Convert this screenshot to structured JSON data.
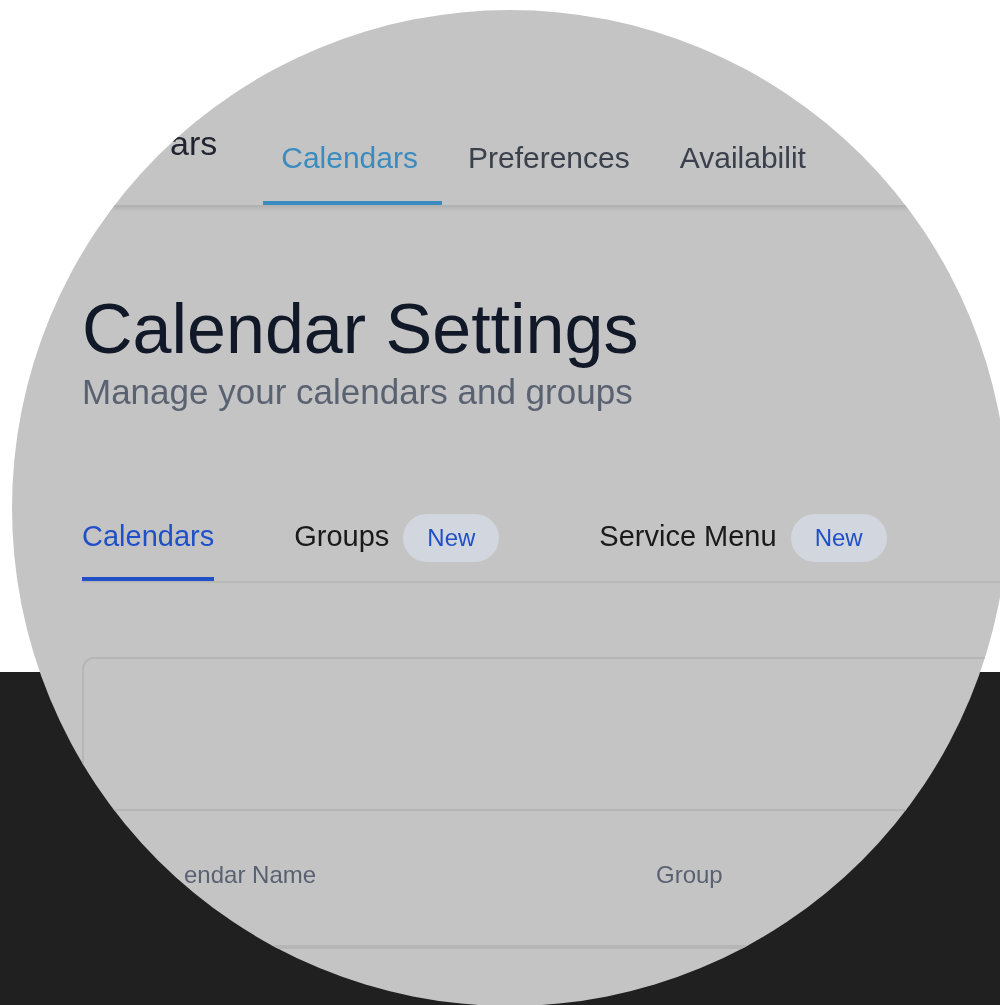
{
  "top_nav": {
    "title_fragment": "ars",
    "tabs": [
      {
        "label": "Calendars",
        "selected": true
      },
      {
        "label": "Preferences",
        "selected": false
      },
      {
        "label": "Availabilit",
        "selected": false
      }
    ]
  },
  "page": {
    "title": "Calendar Settings",
    "subtitle": "Manage your calendars and groups"
  },
  "tabs": [
    {
      "label": "Calendars",
      "selected": true
    },
    {
      "label": "Groups",
      "selected": false,
      "badge": "New"
    },
    {
      "label": "Service Menu",
      "selected": false,
      "badge": "New"
    }
  ],
  "table": {
    "columns": [
      "endar Name",
      "Group"
    ]
  }
}
